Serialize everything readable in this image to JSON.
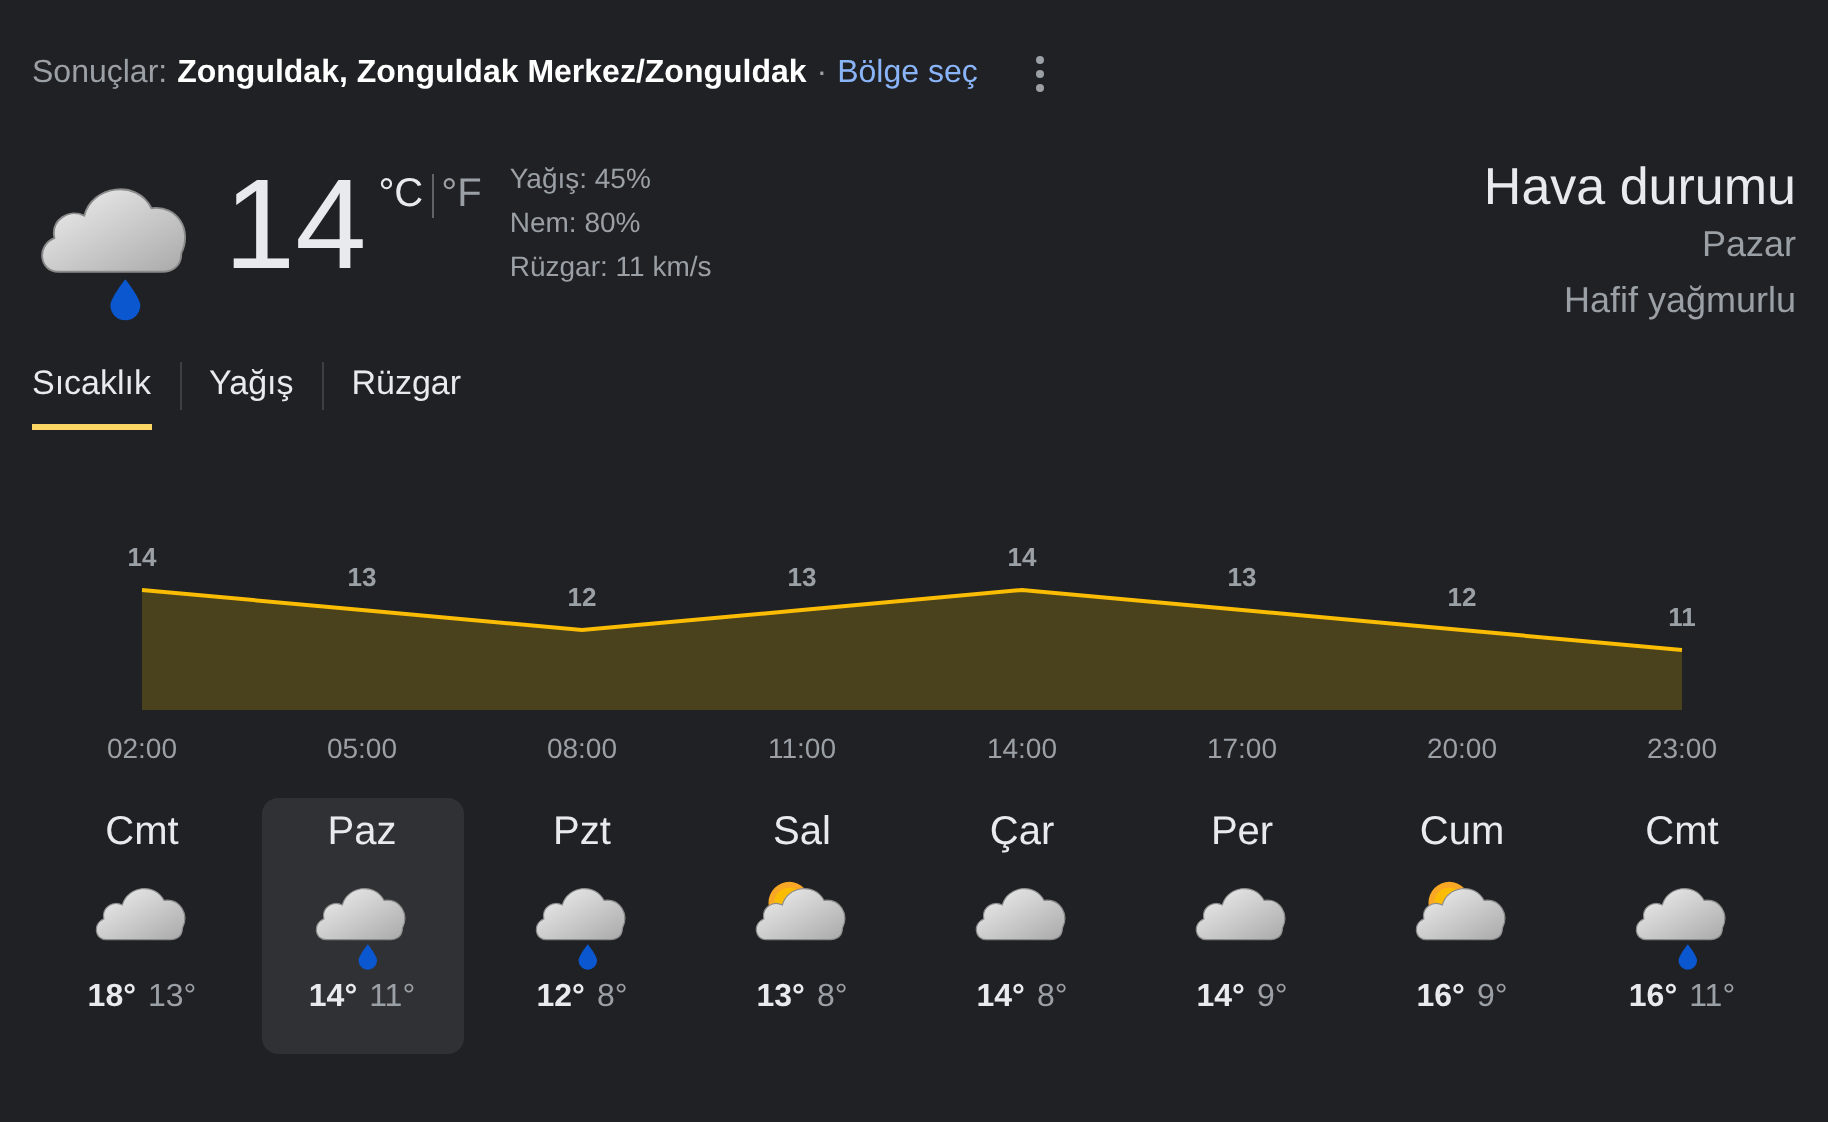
{
  "header": {
    "prefix": "Sonuçlar:",
    "location": "Zonguldak, Zonguldak Merkez/Zonguldak",
    "separator": "·",
    "region_link": "Bölge seç"
  },
  "current": {
    "kind": "rain",
    "temperature": "14",
    "units": [
      {
        "label": "°C",
        "selected": true
      },
      {
        "label": "°F",
        "selected": false
      }
    ],
    "details": [
      "Yağış: 45%",
      "Nem: 80%",
      "Rüzgar: 11 km/s"
    ],
    "title": "Hava durumu",
    "day": "Pazar",
    "condition": "Hafif yağmurlu"
  },
  "tabs": [
    {
      "label": "Sıcaklık",
      "selected": true
    },
    {
      "label": "Yağış",
      "selected": false
    },
    {
      "label": "Rüzgar",
      "selected": false
    }
  ],
  "chart_data": {
    "type": "area",
    "categories": [
      "02:00",
      "05:00",
      "08:00",
      "11:00",
      "14:00",
      "17:00",
      "20:00",
      "23:00"
    ],
    "series": [
      {
        "color": "#fbbc04",
        "values": [
          14,
          13,
          12,
          13,
          14,
          13,
          12,
          11
        ]
      }
    ],
    "data_labels": true
  },
  "days": [
    {
      "day": "Cmt",
      "kind": "cloudy",
      "high": "18°",
      "low": "13°",
      "selected": false
    },
    {
      "day": "Paz",
      "kind": "rain",
      "high": "14°",
      "low": "11°",
      "selected": true
    },
    {
      "day": "Pzt",
      "kind": "rain",
      "high": "12°",
      "low": "8°",
      "selected": false
    },
    {
      "day": "Sal",
      "kind": "partly_sunny",
      "high": "13°",
      "low": "8°",
      "selected": false
    },
    {
      "day": "Çar",
      "kind": "cloudy",
      "high": "14°",
      "low": "8°",
      "selected": false
    },
    {
      "day": "Per",
      "kind": "cloudy",
      "high": "14°",
      "low": "9°",
      "selected": false
    },
    {
      "day": "Cum",
      "kind": "partly_sunny",
      "high": "16°",
      "low": "9°",
      "selected": false
    },
    {
      "day": "Cmt",
      "kind": "rain",
      "high": "16°",
      "low": "11°",
      "selected": false
    }
  ]
}
